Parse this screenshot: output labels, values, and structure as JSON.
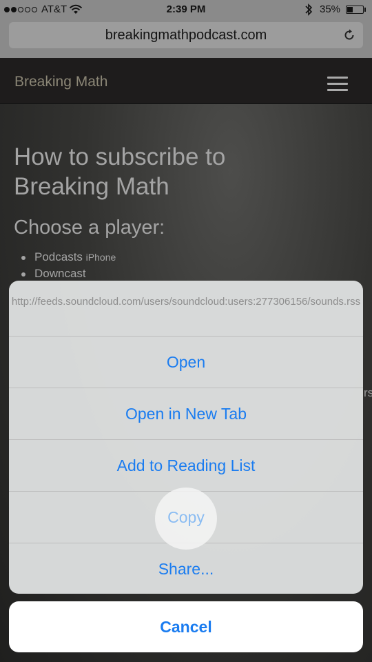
{
  "status_bar": {
    "carrier": "AT&T",
    "time": "2:39 PM",
    "battery_percent": "35%",
    "battery_level": 0.35,
    "signal_bars": 2,
    "signal_total": 5
  },
  "browser": {
    "url": "breakingmathpodcast.com"
  },
  "site": {
    "brand": "Breaking Math",
    "title": "How to subscribe to Breaking Math",
    "subtitle": "Choose a player:",
    "players": [
      {
        "name": "Podcasts",
        "note": "iPhone"
      },
      {
        "name": "Downcast",
        "note": ""
      }
    ],
    "partial_text": "rs"
  },
  "action_sheet": {
    "link_url": "http://feeds.soundcloud.com/users/soundcloud:users:277306156/sounds.rss",
    "actions": [
      {
        "label": "Open"
      },
      {
        "label": "Open in New Tab"
      },
      {
        "label": "Add to Reading List"
      },
      {
        "label": "Copy"
      },
      {
        "label": "Share..."
      }
    ],
    "cancel_label": "Cancel"
  },
  "colors": {
    "action_blue": "#1a7cf0",
    "pressed_blue": "#8abcf2"
  }
}
